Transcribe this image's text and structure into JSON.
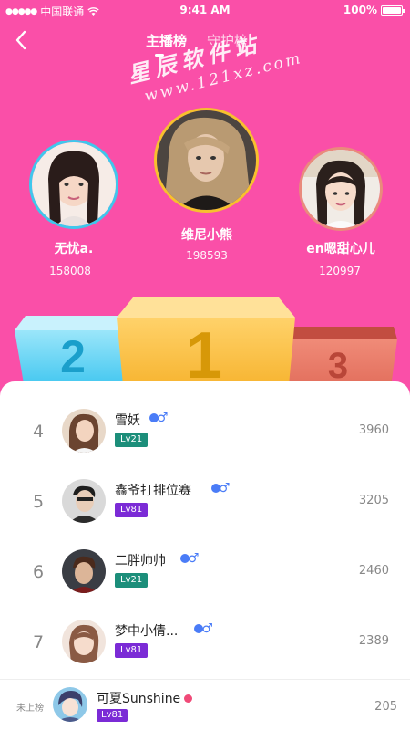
{
  "status": {
    "carrier": "中国联通",
    "time": "9:41 AM",
    "battery": "100%"
  },
  "nav": {
    "tabs": [
      {
        "label": "主播榜",
        "active": true
      },
      {
        "label": "守护榜",
        "active": false
      }
    ]
  },
  "watermark": {
    "line1": "星辰软件站",
    "line2": "www.121xz.com"
  },
  "top3": [
    {
      "rank": "2",
      "name": "无忧a.",
      "score": "158008"
    },
    {
      "rank": "1",
      "name": "维尼小熊",
      "score": "198593"
    },
    {
      "rank": "3",
      "name": "en嗯甜心儿",
      "score": "120997"
    }
  ],
  "list": [
    {
      "rank": "4",
      "name": "雪妖",
      "level": "Lv21",
      "level_color": "#1c8e7a",
      "score": "3960"
    },
    {
      "rank": "5",
      "name": "鑫爷打排位赛",
      "level": "Lv81",
      "level_color": "#7b2bd6",
      "score": "3205"
    },
    {
      "rank": "6",
      "name": "二胖帅帅",
      "level": "Lv21",
      "level_color": "#1c8e7a",
      "score": "2460"
    },
    {
      "rank": "7",
      "name": "梦中小倩...",
      "level": "Lv81",
      "level_color": "#7b2bd6",
      "score": "2389"
    }
  ],
  "me": {
    "label": "未上榜",
    "name": "可夏Sunshine",
    "level": "Lv81",
    "score": "205"
  },
  "colors": {
    "background": "#fa4fa8",
    "podium_gold": "#f7b32d",
    "podium_blue": "#3fc7ec",
    "podium_bronze": "#e26a59",
    "male": "#4a7cf7"
  },
  "icons": {
    "back": "chevron-left-icon",
    "male": "male-gender-icon"
  }
}
